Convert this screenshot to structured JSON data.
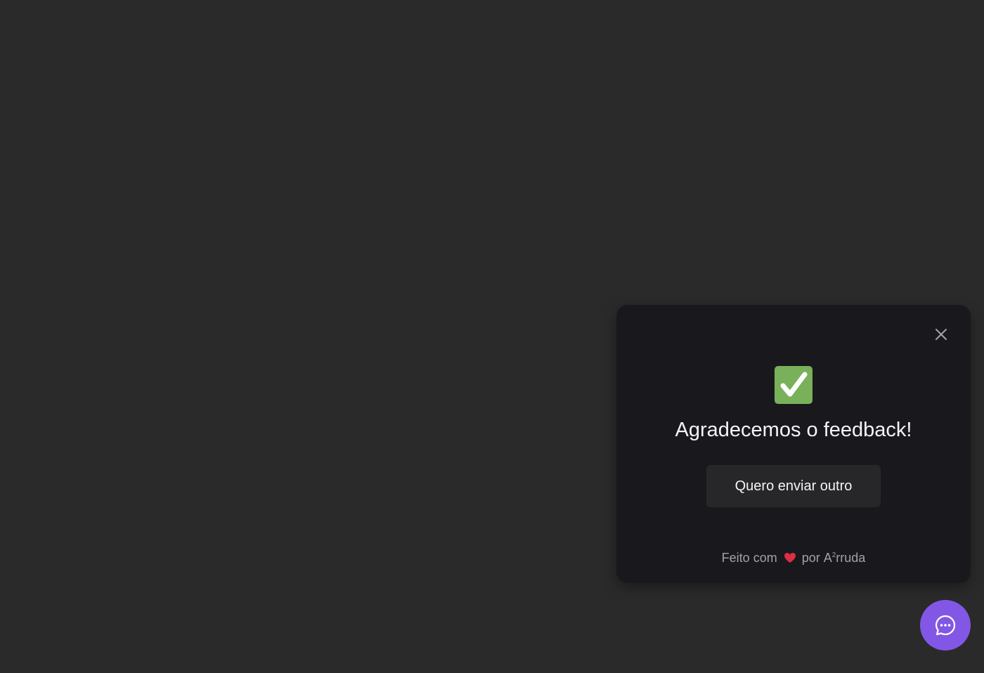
{
  "widget": {
    "title": "Agradecemos o feedback!",
    "again_label": "Quero enviar outro",
    "footer": {
      "made_with": "Feito com",
      "by": "por",
      "author_prefix": "A",
      "author_sup": "2",
      "author_suffix": "rruda"
    }
  },
  "icons": {
    "success": "check-mark-button-icon",
    "close": "close-icon",
    "heart": "heart-icon",
    "chat": "chat-bubble-icon"
  },
  "colors": {
    "page_background": "#2a2a2a",
    "widget_background": "#19191d",
    "button_background": "#27272a",
    "brand": "#8257e5",
    "success": "#78b159",
    "heart": "#dd2e44"
  }
}
